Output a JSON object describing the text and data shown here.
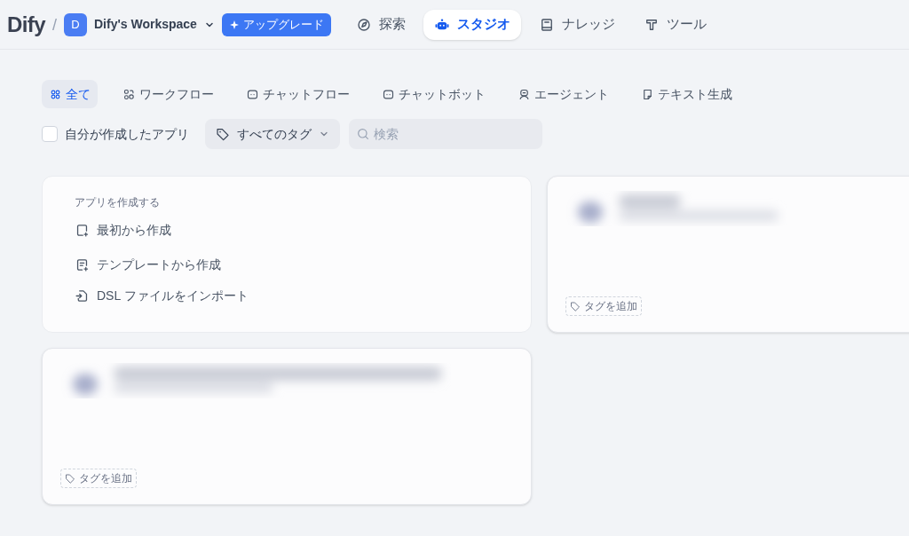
{
  "header": {
    "logo": "Dify",
    "separator": "/",
    "workspace": {
      "initial": "D",
      "name": "Dify's Workspace"
    },
    "upgrade_button": "アップグレード",
    "nav": [
      {
        "label": "探索",
        "selected": false
      },
      {
        "label": "スタジオ",
        "selected": true
      },
      {
        "label": "ナレッジ",
        "selected": false
      },
      {
        "label": "ツール",
        "selected": false
      }
    ]
  },
  "filters": [
    {
      "label": "全て",
      "selected": true
    },
    {
      "label": "ワークフロー",
      "selected": false
    },
    {
      "label": "チャットフロー",
      "selected": false
    },
    {
      "label": "チャットボット",
      "selected": false
    },
    {
      "label": "エージェント",
      "selected": false
    },
    {
      "label": "テキスト生成",
      "selected": false
    }
  ],
  "my_apps_checkbox": {
    "label": "自分が作成したアプリ",
    "checked": false
  },
  "tag_filter": "すべてのタグ",
  "search": {
    "placeholder": "検索"
  },
  "create_card": {
    "title": "アプリを作成する",
    "actions": [
      "最初から作成",
      "テンプレートから作成",
      "DSL ファイルをインポート"
    ]
  },
  "app_cards": [
    {
      "kind": "blurred",
      "tag_button": "タグを追加"
    },
    {
      "kind": "blurred",
      "tag_button": "タグを追加"
    }
  ]
}
